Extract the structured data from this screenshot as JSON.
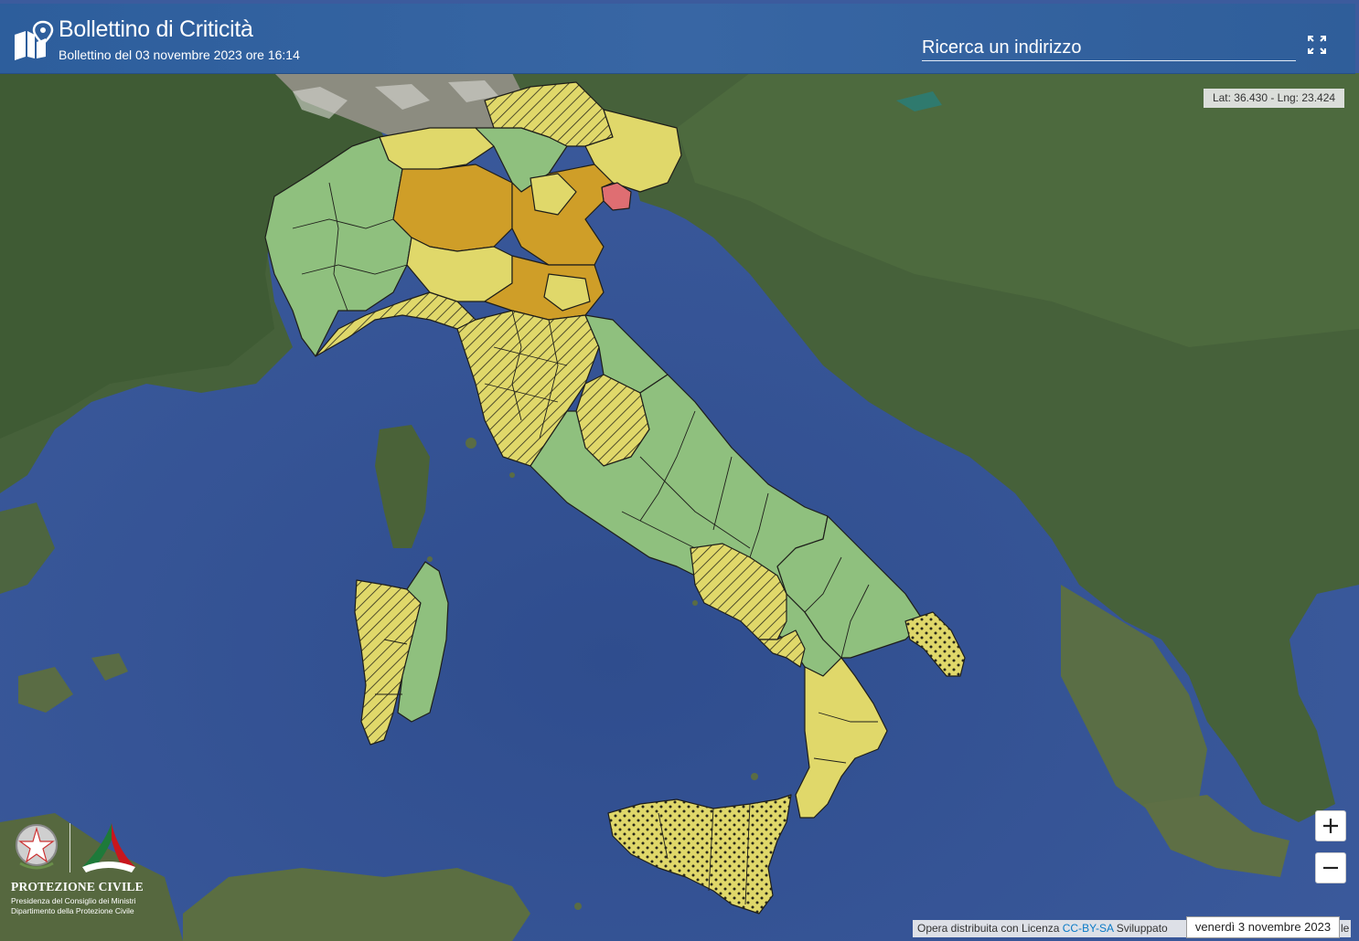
{
  "header": {
    "title": "Bollettino di Criticità",
    "subtitle": "Bollettino del 03 novembre 2023 ore 16:14",
    "search_placeholder": "Ricerca un indirizzo",
    "logo_icon": "map-pin-icon",
    "fullscreen_icon": "fullscreen-icon"
  },
  "map": {
    "coords": "Lat: 36.430 - Lng: 23.424",
    "legend_colors": {
      "green": "#8fc07e",
      "yellow": "#e0d86a",
      "orange": "#cf9e28",
      "red": "#df6e72",
      "sea": "#3a5596"
    }
  },
  "controls": {
    "zoom_in_icon": "plus-icon",
    "zoom_out_icon": "minus-icon"
  },
  "branding": {
    "name": "PROTEZIONE CIVILE",
    "line1": "Presidenza del Consiglio dei Ministri",
    "line2": "Dipartimento della Protezione Civile"
  },
  "footer": {
    "attribution_prefix": "Opera distribuita con Licenza",
    "license_link": "CC-BY-SA",
    "attribution_suffix": "Sviluppato",
    "attribution_tail": "le",
    "date": "venerdì 3 novembre 2023"
  }
}
